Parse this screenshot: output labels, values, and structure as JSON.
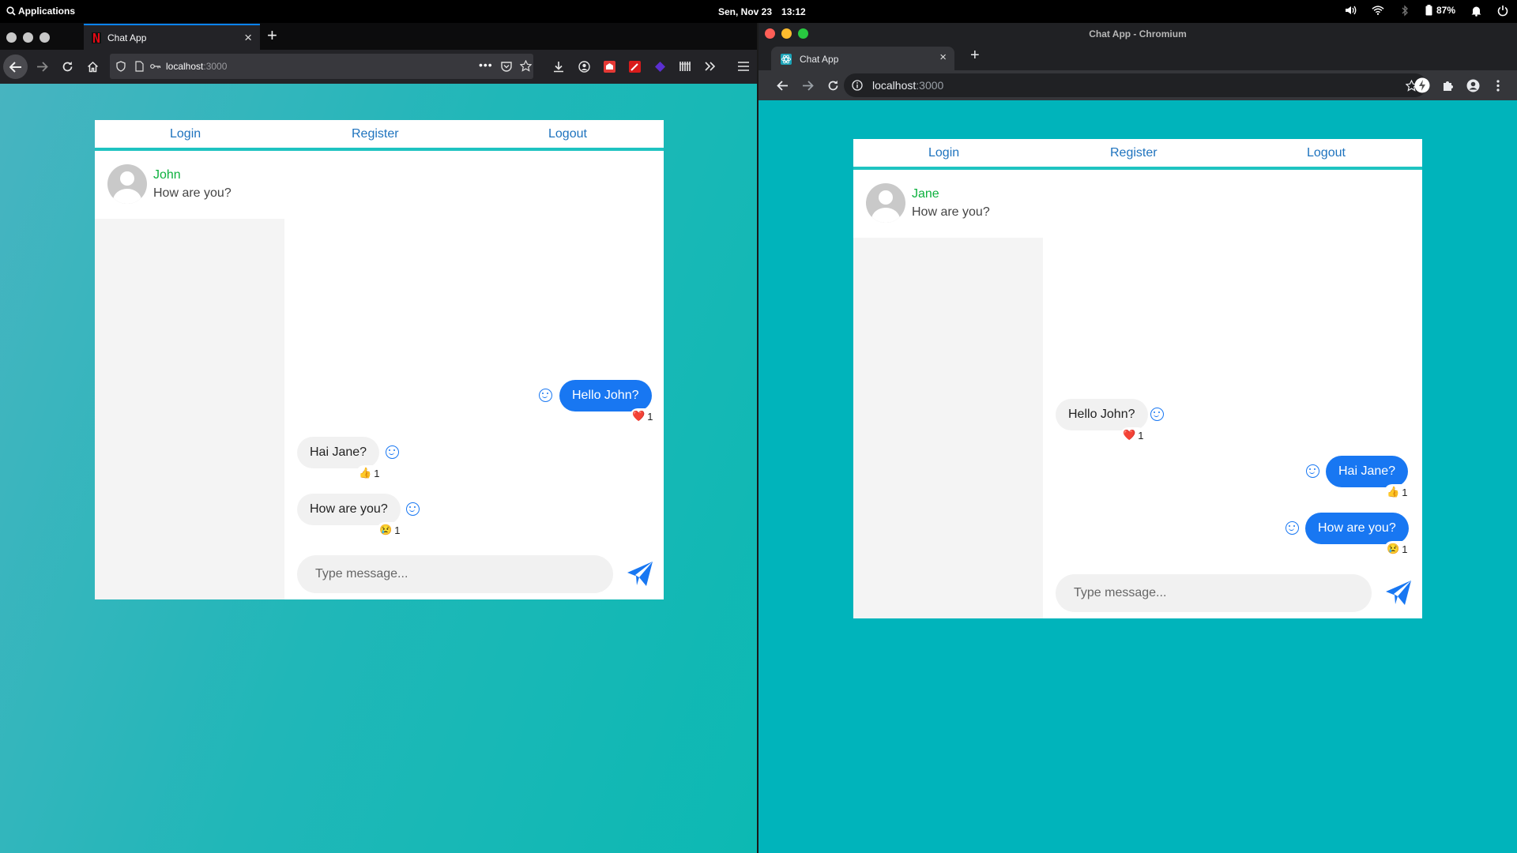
{
  "topbar": {
    "applications": "Applications",
    "date": "Sen, Nov 23",
    "time": "13:12",
    "battery": "87%"
  },
  "firefox": {
    "tab_title": "Chat App",
    "url_host": "localhost",
    "url_port": ":3000"
  },
  "chromium": {
    "window_title": "Chat App - Chromium",
    "tab_title": "Chat App",
    "url_host": "localhost",
    "url_port": ":3000"
  },
  "app_left": {
    "nav": {
      "login": "Login",
      "register": "Register",
      "logout": "Logout"
    },
    "contact": {
      "name": "John",
      "last_message": "How are you?"
    },
    "messages": [
      {
        "text": "Hello John?",
        "direction": "outgoing",
        "reaction": "❤️",
        "count": "1"
      },
      {
        "text": "Hai Jane?",
        "direction": "incoming",
        "reaction": "👍",
        "count": "1"
      },
      {
        "text": "How are you?",
        "direction": "incoming",
        "reaction": "😢",
        "count": "1"
      }
    ],
    "composer_placeholder": "Type message..."
  },
  "app_right": {
    "nav": {
      "login": "Login",
      "register": "Register",
      "logout": "Logout"
    },
    "contact": {
      "name": "Jane",
      "last_message": "How are you?"
    },
    "messages": [
      {
        "text": "Hello John?",
        "direction": "incoming",
        "reaction": "❤️",
        "count": "1"
      },
      {
        "text": "Hai Jane?",
        "direction": "outgoing",
        "reaction": "👍",
        "count": "1"
      },
      {
        "text": "How are you?",
        "direction": "outgoing",
        "reaction": "😢",
        "count": "1"
      }
    ],
    "composer_placeholder": "Type message..."
  },
  "colors": {
    "accent_blue": "#1877f2",
    "link_blue": "#1e73be",
    "contact_green": "#0db13e",
    "divider_teal": "#1ec3c1"
  }
}
